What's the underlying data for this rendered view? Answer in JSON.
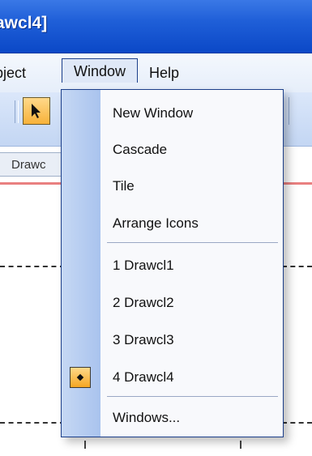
{
  "window": {
    "title": "awcl4]"
  },
  "menubar": {
    "items": [
      {
        "label": "bject"
      },
      {
        "label": "Window"
      },
      {
        "label": "Help"
      }
    ]
  },
  "document_tab": {
    "label": "Drawc"
  },
  "window_menu": {
    "items": [
      {
        "label": "New Window",
        "checked": false
      },
      {
        "label": "Cascade",
        "checked": false
      },
      {
        "label": "Tile",
        "checked": false
      },
      {
        "label": "Arrange Icons",
        "checked": false
      },
      {
        "label": "1 Drawcl1",
        "checked": false
      },
      {
        "label": "2 Drawcl2",
        "checked": false
      },
      {
        "label": "3 Drawcl3",
        "checked": false
      },
      {
        "label": "4 Drawcl4",
        "checked": true
      },
      {
        "label": "Windows...",
        "checked": false
      }
    ]
  },
  "colors": {
    "title_bar": "#1f5fd8",
    "highlight": "#f5a623",
    "menu_border": "#1c3f8a"
  }
}
